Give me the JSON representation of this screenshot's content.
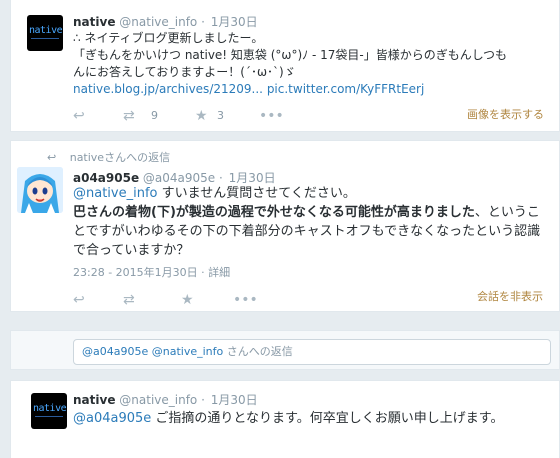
{
  "tweets": [
    {
      "name": "native",
      "handle": "@native_info",
      "dot": "·",
      "date": "1月30日",
      "avatar_text": "native",
      "text_line1": "∴ ネイティブログ更新しましたー。",
      "text_line2": "「ぎもんをかいけつ native! 知恵袋 (°ω°)ﾉ - 17袋目-」皆様からのぎもんしつも",
      "text_line3": "んにお答えしておりますよー！(´･ω･`)ゞ",
      "link_blog": "native.blog.jp/archives/21209...",
      "link_pic": "pic.twitter.com/KyFFRtEerj",
      "retweet_count": "9",
      "favorite_count": "3",
      "show_image": "画像を表示する"
    },
    {
      "replied_to": "nativeさんへの返信",
      "name": "a04a905e",
      "handle": "@a04a905e",
      "dot": "·",
      "date": "1月30日",
      "mention": "@native_info",
      "text_line1_rest": " すいません質問させてください。",
      "text_line2_bold": "巴さんの着物(下)が製造の過程で外せなくなる可能性が高まりました",
      "text_line2_rest": "、というこ",
      "text_line3": "とですがいわゆるその下の下着部分のキャストオフもできなくなったという認識",
      "text_line4": "で合っていますか？",
      "meta_time": "23:28 - 2015年1月30日",
      "meta_sep": "·",
      "meta_detail": "詳細",
      "hide_convo": "会話を非表示"
    }
  ],
  "reply_box": {
    "mention1": "@a04a905e",
    "mention2": "@native_info",
    "suffix": " さんへの返信"
  },
  "tweet3": {
    "name": "native",
    "handle": "@native_info",
    "dot": "·",
    "date": "1月30日",
    "avatar_text": "native",
    "mention": "@a04a905e",
    "text_rest": " ご指摘の通りとなります。何卒宜しくお願い申し上げます。"
  },
  "icons": [
    "reply-icon",
    "retweet-icon",
    "favorite-icon",
    "more-icon"
  ],
  "colors": {
    "link": "#2b7bb9",
    "muted": "#8899a6",
    "background": "#e6ecf0",
    "gold_link": "#b08640"
  }
}
